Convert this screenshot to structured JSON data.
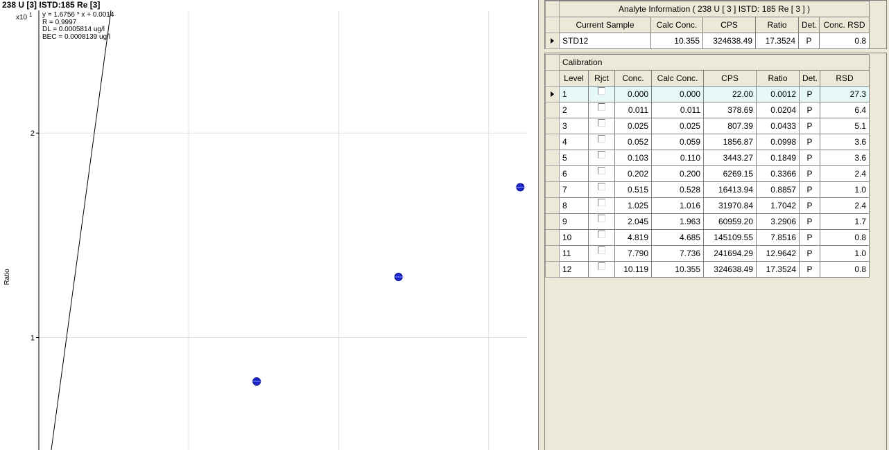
{
  "chart_data": {
    "type": "scatter",
    "title": "238 U [3] ISTD:185 Re [3]",
    "ylabel": "Ratio",
    "y_multiplier": "x10",
    "y_multiplier_exp": "1",
    "xlim": [
      0,
      10.5
    ],
    "ylim": [
      0.45,
      2.6
    ],
    "yticks": [
      {
        "v": 2,
        "label": "2"
      },
      {
        "v": 1,
        "label": "1"
      }
    ],
    "x_gridlines": [
      3.225,
      6.45,
      9.675
    ],
    "fit_line": {
      "slope": 1.6756,
      "intercept": 0.0014
    },
    "points": [
      {
        "x": 4.685,
        "y": 0.78516
      },
      {
        "x": 7.736,
        "y": 1.29642
      },
      {
        "x": 10.355,
        "y": 1.73524
      }
    ],
    "fit_text": {
      "equation": "y = 1.6756 * x  + 0.0014",
      "r": "R =  0.9997",
      "dl": "DL = 0.0005814 ug/l",
      "bec": "BEC = 0.0008139 ug/l"
    },
    "point_color": "#1c26c8"
  },
  "analyte": {
    "title": "Analyte Information ( 238  U  [ 3 ]  ISTD: 185  Re  [ 3 ] )",
    "headers": [
      "Current Sample",
      "Calc Conc.",
      "CPS",
      "Ratio",
      "Det.",
      "Conc. RSD"
    ],
    "row": [
      "STD12",
      "10.355",
      "324638.49",
      "17.3524",
      "P",
      "0.8"
    ]
  },
  "calibration": {
    "title": "Calibration",
    "headers": [
      "Level",
      "Rjct",
      "Conc.",
      "Calc Conc.",
      "CPS",
      "Ratio",
      "Det.",
      "RSD"
    ],
    "rows": [
      [
        "1",
        "",
        "0.000",
        "0.000",
        "22.00",
        "0.0012",
        "P",
        "27.3"
      ],
      [
        "2",
        "",
        "0.011",
        "0.011",
        "378.69",
        "0.0204",
        "P",
        "6.4"
      ],
      [
        "3",
        "",
        "0.025",
        "0.025",
        "807.39",
        "0.0433",
        "P",
        "5.1"
      ],
      [
        "4",
        "",
        "0.052",
        "0.059",
        "1856.87",
        "0.0998",
        "P",
        "3.6"
      ],
      [
        "5",
        "",
        "0.103",
        "0.110",
        "3443.27",
        "0.1849",
        "P",
        "3.6"
      ],
      [
        "6",
        "",
        "0.202",
        "0.200",
        "6269.15",
        "0.3366",
        "P",
        "2.4"
      ],
      [
        "7",
        "",
        "0.515",
        "0.528",
        "16413.94",
        "0.8857",
        "P",
        "1.0"
      ],
      [
        "8",
        "",
        "1.025",
        "1.016",
        "31970.84",
        "1.7042",
        "P",
        "2.4"
      ],
      [
        "9",
        "",
        "2.045",
        "1.963",
        "60959.20",
        "3.2906",
        "P",
        "1.7"
      ],
      [
        "10",
        "",
        "4.819",
        "4.685",
        "145109.55",
        "7.8516",
        "P",
        "0.8"
      ],
      [
        "11",
        "",
        "7.790",
        "7.736",
        "241694.29",
        "12.9642",
        "P",
        "1.0"
      ],
      [
        "12",
        "",
        "10.119",
        "10.355",
        "324638.49",
        "17.3524",
        "P",
        "0.8"
      ]
    ]
  }
}
